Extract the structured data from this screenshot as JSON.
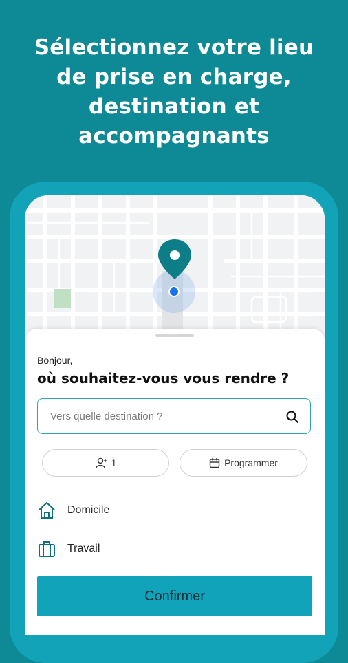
{
  "headline": {
    "lines": [
      "Sélectionnez votre lieu",
      "de prise en charge,",
      "destination et",
      "accompagnants"
    ]
  },
  "map": {
    "pin_icon": "location-pin-icon",
    "current_location_icon": "current-location-dot-icon"
  },
  "sheet": {
    "greeting": "Bonjour,",
    "question": "où souhaitez-vous vous rendre ?",
    "search": {
      "placeholder": "Vers quelle destination ?",
      "icon": "search-icon"
    },
    "passengers": {
      "icon": "person-icon",
      "value": "1"
    },
    "schedule": {
      "icon": "calendar-icon",
      "label": "Programmer"
    },
    "saved_places": [
      {
        "icon": "home-icon",
        "label": "Domicile"
      },
      {
        "icon": "briefcase-icon",
        "label": "Travail"
      }
    ],
    "confirm_label": "Confirmer"
  },
  "colors": {
    "background": "#0e8a96",
    "phone_frame": "#12a3b8",
    "accent": "#11a3ba",
    "location_dot": "#1a73e8"
  }
}
